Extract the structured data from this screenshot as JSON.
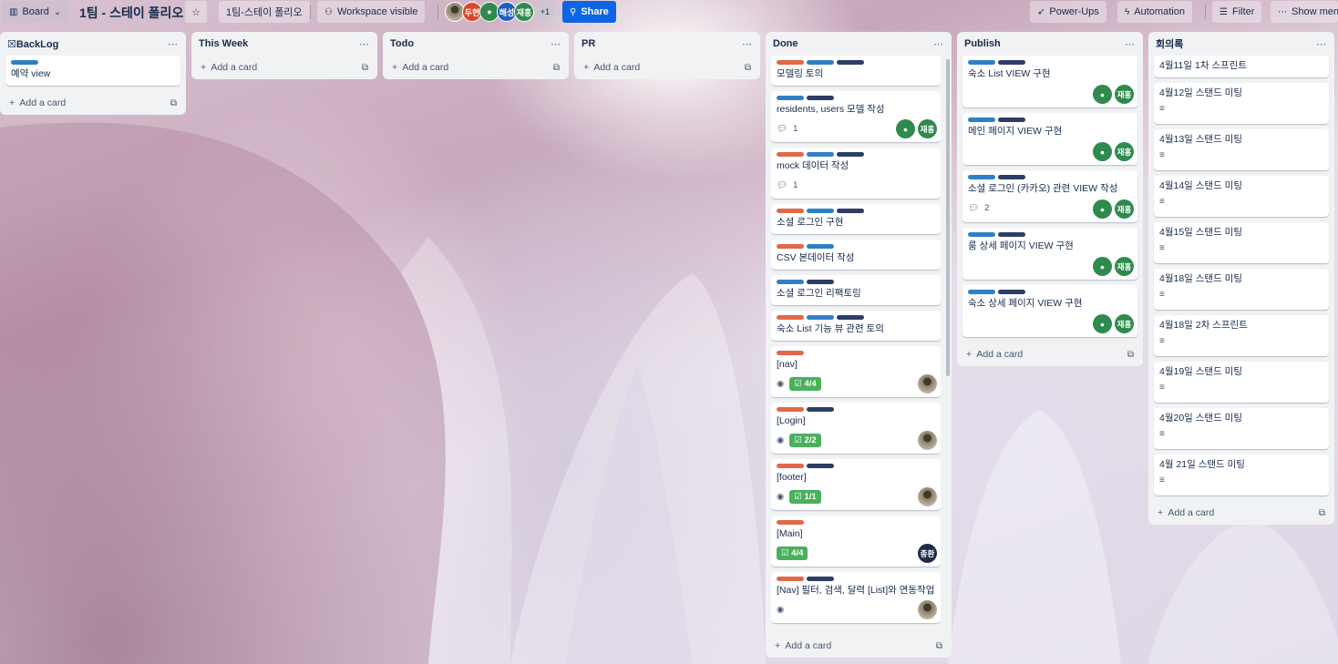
{
  "header": {
    "board_view": "Board",
    "board_title": "1팀 - 스테이 폴리오",
    "workspace_name": "1팀-스테이 폴리오",
    "visibility": "Workspace visible",
    "members": [
      "두현",
      "해성",
      "재홍"
    ],
    "members_more": "+1",
    "share": "Share",
    "power_ups": "Power-Ups",
    "automation": "Automation",
    "filter": "Filter",
    "show_menu": "Show menu"
  },
  "add_card_label": "Add a card",
  "lists": {
    "backlog": {
      "title": "☒BackLog",
      "cards": [
        {
          "title": "예약 view"
        }
      ]
    },
    "this_week": {
      "title": "This Week"
    },
    "todo": {
      "title": "Todo"
    },
    "pr": {
      "title": "PR"
    },
    "done": {
      "title": "Done",
      "cards": [
        {
          "title": "모델링 토의"
        },
        {
          "title": "residents, users 모델 작성",
          "comments": "1",
          "avatar": "재홍"
        },
        {
          "title": "mock 데이터 작성",
          "comments": "1"
        },
        {
          "title": "소셜 로그인 구현"
        },
        {
          "title": "CSV 본데이터 작성"
        },
        {
          "title": "소셜 로그인 리팩토링"
        },
        {
          "title": "숙소 List 기능 뷰 관련 토의"
        },
        {
          "title": "[nav]",
          "checklist": "4/4"
        },
        {
          "title": "[Login]",
          "checklist": "2/2"
        },
        {
          "title": "[footer]",
          "checklist": "1/1"
        },
        {
          "title": "[Main]",
          "checklist": "4/4",
          "avatar": "종환"
        },
        {
          "title": "[Nav] 필터, 검색, 달력 [List]와 연동작업"
        }
      ]
    },
    "publish": {
      "title": "Publish",
      "avatar": "재홍",
      "cards": [
        {
          "title": "숙소 List VIEW 구현"
        },
        {
          "title": "메인 페이지 VIEW 구현"
        },
        {
          "title": "소셜 로그인 (카카오) 관련 VIEW 작성",
          "comments": "2"
        },
        {
          "title": "룸 상세 페이지 VIEW 구현"
        },
        {
          "title": "숙소 상세 페이지 VIEW 구현"
        }
      ]
    },
    "minutes": {
      "title": "회의록",
      "cards": [
        {
          "title": "4월11일 1차 스프린트"
        },
        {
          "title": "4월12일 스탠드 미팅"
        },
        {
          "title": "4월13일 스탠드 미팅"
        },
        {
          "title": "4월14일 스탠드 미팅"
        },
        {
          "title": "4월15일 스탠드 미팅"
        },
        {
          "title": "4월18일 스탠드 미팅"
        },
        {
          "title": "4월18일 2차 스프린트"
        },
        {
          "title": "4월19일 스탠드 미팅"
        },
        {
          "title": "4월20일 스탠드 미팅"
        },
        {
          "title": "4월 21일 스탠드 미팅"
        }
      ]
    }
  },
  "colors": {
    "label_red": "#e2674a",
    "label_blue": "#2f80c7",
    "label_navy": "#2e3d66",
    "checklist_done": "#4bb05d",
    "share": "#0c66e4",
    "avatar_green": "#2f8a4e"
  }
}
